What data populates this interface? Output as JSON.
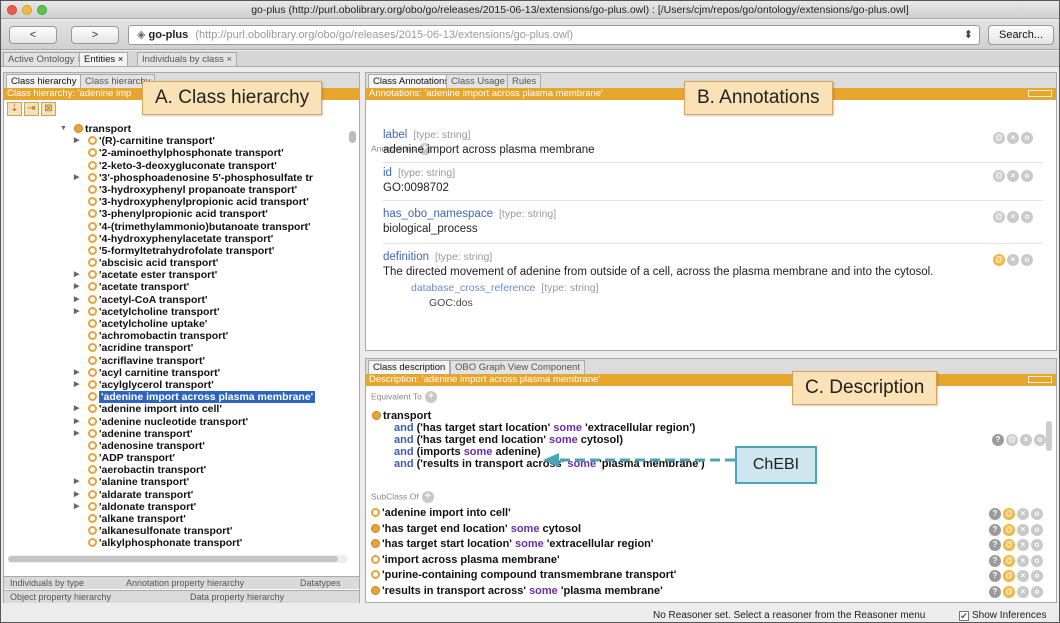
{
  "window": {
    "title": "go-plus (http://purl.obolibrary.org/obo/go/releases/2015-06-13/extensions/go-plus.owl) : [/Users/cjm/repos/go/ontology/extensions/go-plus.owl]"
  },
  "toolbar": {
    "back": "<",
    "forward": ">",
    "ontology_name": "go-plus",
    "ontology_url": "(http://purl.obolibrary.org/obo/go/releases/2015-06-13/extensions/go-plus.owl)",
    "search": "Search..."
  },
  "tabs": [
    "Active Ontology ×",
    "Entities ×",
    "Individuals by class ×"
  ],
  "left": {
    "tabs": [
      "Class hierarchy",
      "Class hierarchy"
    ],
    "header": "Class hierarchy: 'adenine imp",
    "tree": [
      {
        "label": "transport",
        "level": 0,
        "arrow": "down",
        "icon": "full"
      },
      {
        "label": "'(R)-carnitine transport'",
        "level": 1,
        "arrow": "right",
        "icon": "ring"
      },
      {
        "label": "'2-aminoethylphosphonate transport'",
        "level": 1,
        "arrow": "",
        "icon": "ring"
      },
      {
        "label": "'2-keto-3-deoxygluconate transport'",
        "level": 1,
        "arrow": "",
        "icon": "ring"
      },
      {
        "label": "'3'-phosphoadenosine 5'-phosphosulfate tr",
        "level": 1,
        "arrow": "right",
        "icon": "ring"
      },
      {
        "label": "'3-hydroxyphenyl propanoate transport'",
        "level": 1,
        "arrow": "",
        "icon": "ring"
      },
      {
        "label": "'3-hydroxyphenylpropionic acid transport'",
        "level": 1,
        "arrow": "",
        "icon": "ring"
      },
      {
        "label": "'3-phenylpropionic acid transport'",
        "level": 1,
        "arrow": "",
        "icon": "ring"
      },
      {
        "label": "'4-(trimethylammonio)butanoate transport'",
        "level": 1,
        "arrow": "",
        "icon": "ring"
      },
      {
        "label": "'4-hydroxyphenylacetate transport'",
        "level": 1,
        "arrow": "",
        "icon": "ring"
      },
      {
        "label": "'5-formyltetrahydrofolate transport'",
        "level": 1,
        "arrow": "",
        "icon": "ring"
      },
      {
        "label": "'abscisic acid transport'",
        "level": 1,
        "arrow": "",
        "icon": "ring"
      },
      {
        "label": "'acetate ester transport'",
        "level": 1,
        "arrow": "right",
        "icon": "ring"
      },
      {
        "label": "'acetate transport'",
        "level": 1,
        "arrow": "right",
        "icon": "ring"
      },
      {
        "label": "'acetyl-CoA transport'",
        "level": 1,
        "arrow": "right",
        "icon": "ring"
      },
      {
        "label": "'acetylcholine transport'",
        "level": 1,
        "arrow": "right",
        "icon": "ring"
      },
      {
        "label": "'acetylcholine uptake'",
        "level": 1,
        "arrow": "",
        "icon": "ring"
      },
      {
        "label": "'achromobactin transport'",
        "level": 1,
        "arrow": "",
        "icon": "ring"
      },
      {
        "label": "'acridine transport'",
        "level": 1,
        "arrow": "",
        "icon": "ring"
      },
      {
        "label": "'acriflavine transport'",
        "level": 1,
        "arrow": "",
        "icon": "ring"
      },
      {
        "label": "'acyl carnitine transport'",
        "level": 1,
        "arrow": "right",
        "icon": "ring"
      },
      {
        "label": "'acylglycerol transport'",
        "level": 1,
        "arrow": "right",
        "icon": "ring"
      },
      {
        "label": "'adenine import across plasma membrane'",
        "level": 1,
        "arrow": "",
        "icon": "ring",
        "selected": true
      },
      {
        "label": "'adenine import into cell'",
        "level": 1,
        "arrow": "right",
        "icon": "ring"
      },
      {
        "label": "'adenine nucleotide transport'",
        "level": 1,
        "arrow": "right",
        "icon": "ring"
      },
      {
        "label": "'adenine transport'",
        "level": 1,
        "arrow": "right",
        "icon": "ring"
      },
      {
        "label": "'adenosine transport'",
        "level": 1,
        "arrow": "",
        "icon": "ring"
      },
      {
        "label": "'ADP transport'",
        "level": 1,
        "arrow": "",
        "icon": "ring"
      },
      {
        "label": "'aerobactin transport'",
        "level": 1,
        "arrow": "",
        "icon": "ring"
      },
      {
        "label": "'alanine transport'",
        "level": 1,
        "arrow": "right",
        "icon": "ring"
      },
      {
        "label": "'aldarate transport'",
        "level": 1,
        "arrow": "right",
        "icon": "ring"
      },
      {
        "label": "'aldonate transport'",
        "level": 1,
        "arrow": "right",
        "icon": "ring"
      },
      {
        "label": "'alkane transport'",
        "level": 1,
        "arrow": "",
        "icon": "ring"
      },
      {
        "label": "'alkanesulfonate transport'",
        "level": 1,
        "arrow": "",
        "icon": "ring"
      },
      {
        "label": "'alkylphosphonate transport'",
        "level": 1,
        "arrow": "",
        "icon": "ring"
      }
    ],
    "bottom_tabs_1": [
      "Individuals by type",
      "Annotation property hierarchy",
      "Datatypes"
    ],
    "bottom_tabs_2": [
      "Object property hierarchy",
      "Data property hierarchy"
    ]
  },
  "annotations": {
    "tabs": [
      "Class Annotations",
      "Class Usage",
      "Rules"
    ],
    "header": "Annotations: 'adenine import across plasma membrane'",
    "section": "Annotations",
    "items": [
      {
        "key": "label",
        "type": "[type: string]",
        "value": "adenine import across plasma membrane"
      },
      {
        "key": "id",
        "type": "[type: string]",
        "value": "GO:0098702"
      },
      {
        "key": "has_obo_namespace",
        "type": "[type: string]",
        "value": "biological_process"
      },
      {
        "key": "definition",
        "type": "[type: string]",
        "value": "The directed movement of adenine from outside of a cell, across the plasma membrane and into the cytosol.",
        "sub_key": "database_cross_reference",
        "sub_type": "[type: string]",
        "sub_value": "GOC:dos"
      }
    ]
  },
  "description": {
    "tabs": [
      "Class description",
      "OBO Graph View Component"
    ],
    "header": "Description: 'adenine import across plasma membrane'",
    "equivalent_label": "Equivalent To",
    "equivalent": {
      "head": "transport",
      "lines": [
        {
          "pre": "and ('has target start location' ",
          "kw": "some",
          "post": " 'extracellular region')"
        },
        {
          "pre": "and ('has target end location' ",
          "kw": "some",
          "post": " cytosol)"
        },
        {
          "pre": "and (imports ",
          "kw": "some",
          "post": " adenine)"
        },
        {
          "pre": "and ('results in transport across' ",
          "kw": "some",
          "post": " 'plasma membrane')"
        }
      ]
    },
    "subclass_label": "SubClass Of",
    "subclass": [
      {
        "pre": "'adenine import into cell'",
        "kw": "",
        "post": "",
        "icon": "ring"
      },
      {
        "pre": "'has target end location' ",
        "kw": "some",
        "post": " cytosol",
        "icon": "full"
      },
      {
        "pre": "'has target start location' ",
        "kw": "some",
        "post": " 'extracellular region'",
        "icon": "full"
      },
      {
        "pre": "'import across plasma membrane'",
        "kw": "",
        "post": "",
        "icon": "ring"
      },
      {
        "pre": "'purine-containing compound transmembrane transport'",
        "kw": "",
        "post": "",
        "icon": "ring"
      },
      {
        "pre": "'results in transport across' ",
        "kw": "some",
        "post": " 'plasma membrane'",
        "icon": "full"
      }
    ]
  },
  "callouts": {
    "a": "A. Class hierarchy",
    "b": "B. Annotations",
    "c": "C. Description",
    "chebi": "ChEBI"
  },
  "status": {
    "message": "No Reasoner set. Select a reasoner from the Reasoner menu",
    "show_inferences": "Show Inferences"
  },
  "colors": {
    "accent": "#e6a52d",
    "selection": "#2c65c0",
    "callout_bg": "#fbe1b6",
    "chebi_bg": "#cfe6ef",
    "chebi_border": "#4aa5ba"
  }
}
